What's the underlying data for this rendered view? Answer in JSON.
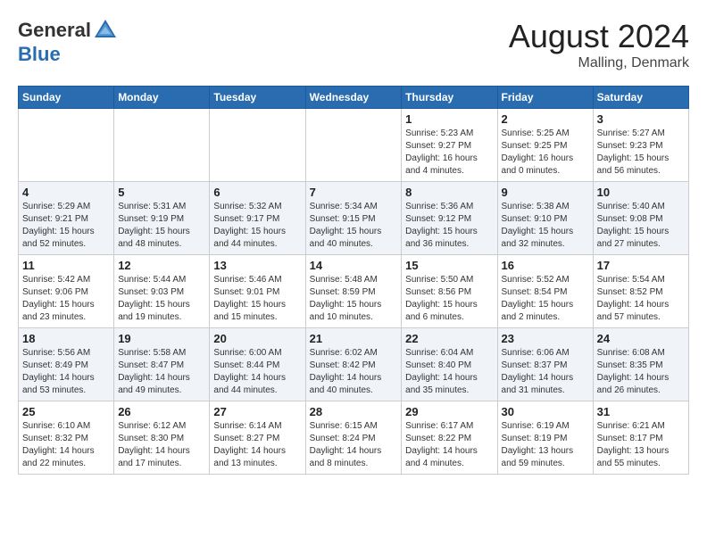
{
  "header": {
    "logo_general": "General",
    "logo_blue": "Blue",
    "month": "August 2024",
    "location": "Malling, Denmark"
  },
  "weekdays": [
    "Sunday",
    "Monday",
    "Tuesday",
    "Wednesday",
    "Thursday",
    "Friday",
    "Saturday"
  ],
  "weeks": [
    [
      {
        "day": "",
        "info": ""
      },
      {
        "day": "",
        "info": ""
      },
      {
        "day": "",
        "info": ""
      },
      {
        "day": "",
        "info": ""
      },
      {
        "day": "1",
        "info": "Sunrise: 5:23 AM\nSunset: 9:27 PM\nDaylight: 16 hours\nand 4 minutes."
      },
      {
        "day": "2",
        "info": "Sunrise: 5:25 AM\nSunset: 9:25 PM\nDaylight: 16 hours\nand 0 minutes."
      },
      {
        "day": "3",
        "info": "Sunrise: 5:27 AM\nSunset: 9:23 PM\nDaylight: 15 hours\nand 56 minutes."
      }
    ],
    [
      {
        "day": "4",
        "info": "Sunrise: 5:29 AM\nSunset: 9:21 PM\nDaylight: 15 hours\nand 52 minutes."
      },
      {
        "day": "5",
        "info": "Sunrise: 5:31 AM\nSunset: 9:19 PM\nDaylight: 15 hours\nand 48 minutes."
      },
      {
        "day": "6",
        "info": "Sunrise: 5:32 AM\nSunset: 9:17 PM\nDaylight: 15 hours\nand 44 minutes."
      },
      {
        "day": "7",
        "info": "Sunrise: 5:34 AM\nSunset: 9:15 PM\nDaylight: 15 hours\nand 40 minutes."
      },
      {
        "day": "8",
        "info": "Sunrise: 5:36 AM\nSunset: 9:12 PM\nDaylight: 15 hours\nand 36 minutes."
      },
      {
        "day": "9",
        "info": "Sunrise: 5:38 AM\nSunset: 9:10 PM\nDaylight: 15 hours\nand 32 minutes."
      },
      {
        "day": "10",
        "info": "Sunrise: 5:40 AM\nSunset: 9:08 PM\nDaylight: 15 hours\nand 27 minutes."
      }
    ],
    [
      {
        "day": "11",
        "info": "Sunrise: 5:42 AM\nSunset: 9:06 PM\nDaylight: 15 hours\nand 23 minutes."
      },
      {
        "day": "12",
        "info": "Sunrise: 5:44 AM\nSunset: 9:03 PM\nDaylight: 15 hours\nand 19 minutes."
      },
      {
        "day": "13",
        "info": "Sunrise: 5:46 AM\nSunset: 9:01 PM\nDaylight: 15 hours\nand 15 minutes."
      },
      {
        "day": "14",
        "info": "Sunrise: 5:48 AM\nSunset: 8:59 PM\nDaylight: 15 hours\nand 10 minutes."
      },
      {
        "day": "15",
        "info": "Sunrise: 5:50 AM\nSunset: 8:56 PM\nDaylight: 15 hours\nand 6 minutes."
      },
      {
        "day": "16",
        "info": "Sunrise: 5:52 AM\nSunset: 8:54 PM\nDaylight: 15 hours\nand 2 minutes."
      },
      {
        "day": "17",
        "info": "Sunrise: 5:54 AM\nSunset: 8:52 PM\nDaylight: 14 hours\nand 57 minutes."
      }
    ],
    [
      {
        "day": "18",
        "info": "Sunrise: 5:56 AM\nSunset: 8:49 PM\nDaylight: 14 hours\nand 53 minutes."
      },
      {
        "day": "19",
        "info": "Sunrise: 5:58 AM\nSunset: 8:47 PM\nDaylight: 14 hours\nand 49 minutes."
      },
      {
        "day": "20",
        "info": "Sunrise: 6:00 AM\nSunset: 8:44 PM\nDaylight: 14 hours\nand 44 minutes."
      },
      {
        "day": "21",
        "info": "Sunrise: 6:02 AM\nSunset: 8:42 PM\nDaylight: 14 hours\nand 40 minutes."
      },
      {
        "day": "22",
        "info": "Sunrise: 6:04 AM\nSunset: 8:40 PM\nDaylight: 14 hours\nand 35 minutes."
      },
      {
        "day": "23",
        "info": "Sunrise: 6:06 AM\nSunset: 8:37 PM\nDaylight: 14 hours\nand 31 minutes."
      },
      {
        "day": "24",
        "info": "Sunrise: 6:08 AM\nSunset: 8:35 PM\nDaylight: 14 hours\nand 26 minutes."
      }
    ],
    [
      {
        "day": "25",
        "info": "Sunrise: 6:10 AM\nSunset: 8:32 PM\nDaylight: 14 hours\nand 22 minutes."
      },
      {
        "day": "26",
        "info": "Sunrise: 6:12 AM\nSunset: 8:30 PM\nDaylight: 14 hours\nand 17 minutes."
      },
      {
        "day": "27",
        "info": "Sunrise: 6:14 AM\nSunset: 8:27 PM\nDaylight: 14 hours\nand 13 minutes."
      },
      {
        "day": "28",
        "info": "Sunrise: 6:15 AM\nSunset: 8:24 PM\nDaylight: 14 hours\nand 8 minutes."
      },
      {
        "day": "29",
        "info": "Sunrise: 6:17 AM\nSunset: 8:22 PM\nDaylight: 14 hours\nand 4 minutes."
      },
      {
        "day": "30",
        "info": "Sunrise: 6:19 AM\nSunset: 8:19 PM\nDaylight: 13 hours\nand 59 minutes."
      },
      {
        "day": "31",
        "info": "Sunrise: 6:21 AM\nSunset: 8:17 PM\nDaylight: 13 hours\nand 55 minutes."
      }
    ]
  ]
}
